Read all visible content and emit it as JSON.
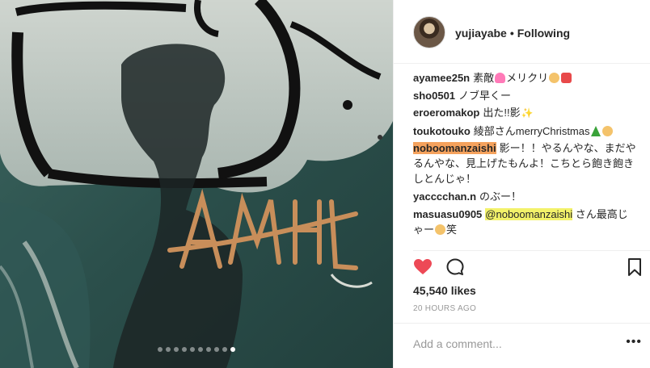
{
  "post": {
    "carousel_dot_count": 10,
    "carousel_active_index": 9
  },
  "header": {
    "username": "yujiayabe",
    "separator": "•",
    "follow_status": "Following"
  },
  "comments": [
    {
      "user": "ayamee25n",
      "text": "素敵",
      "text2": "メリクリ",
      "emoji": [
        "heart",
        "face",
        "gift"
      ]
    },
    {
      "user": "sho0501",
      "text": "ノブ早くー"
    },
    {
      "user": "eroeromakop",
      "text": "出た!!影",
      "emoji": [
        "sparkles"
      ]
    },
    {
      "user": "toukotouko",
      "text": "綾部さんmerryChristmas",
      "emoji": [
        "tree",
        "face"
      ]
    },
    {
      "user": "noboomanzaishi",
      "text": "影ー！！やるんやな、まだやるんやな、見上げたもんよ！こちとら飽き飽きしとんじゃ！"
    },
    {
      "user": "yacccchan.n",
      "text": "のぶー！"
    },
    {
      "user": "masuasu0905",
      "mention": "@noboomanzaishi",
      "text": " さん最高じゃー",
      "text2": "笑",
      "emoji": [
        "face"
      ]
    }
  ],
  "actions": {
    "like_icon": "heart-filled-icon",
    "comment_icon": "comment-bubble-icon",
    "save_icon": "bookmark-icon",
    "like_color": "#ed4956"
  },
  "likes": "45,540 likes",
  "timestamp": "20 HOURS AGO",
  "add_comment": {
    "placeholder": "Add a comment...",
    "more_label": "•••"
  }
}
